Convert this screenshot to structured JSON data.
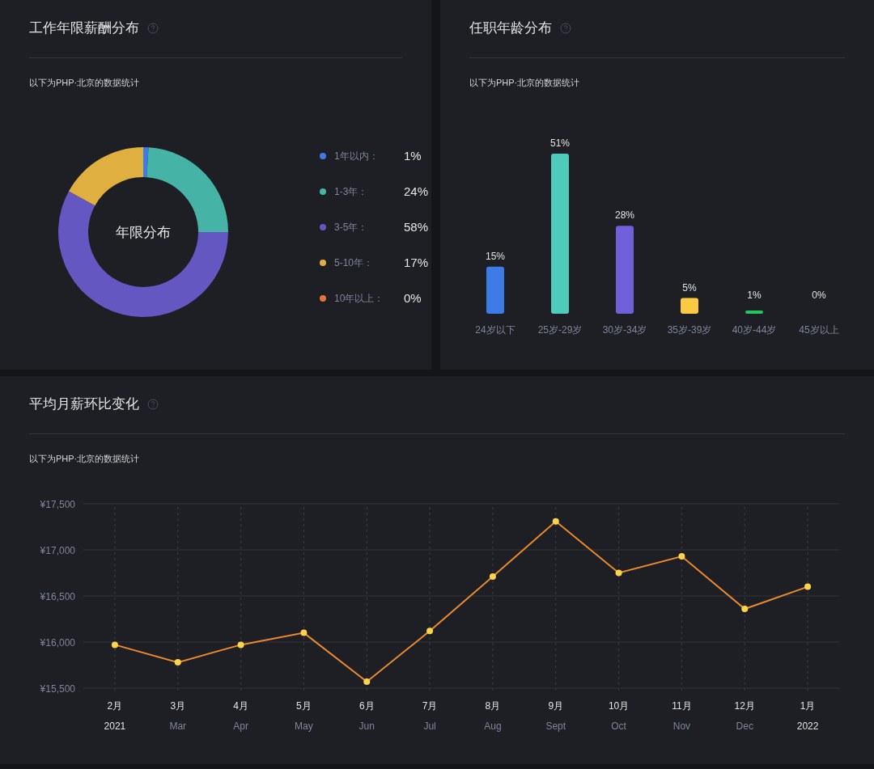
{
  "panels": [
    {
      "title": "工作年限薪酬分布",
      "subtitle": "以下为PHP·北京的数据统计",
      "center_label": "年限分布",
      "chart_data": {
        "type": "donut",
        "values": [
          1,
          24,
          58,
          17,
          0
        ]
      },
      "legend": [
        {
          "label": "1年以内：",
          "value": "1%",
          "color": "#3d7be6"
        },
        {
          "label": "1-3年：",
          "value": "24%",
          "color": "#45b4a6"
        },
        {
          "label": "3-5年：",
          "value": "58%",
          "color": "#6557c2"
        },
        {
          "label": "5-10年：",
          "value": "17%",
          "color": "#dfb03f"
        },
        {
          "label": "10年以上：",
          "value": "0%",
          "color": "#e8743b"
        }
      ]
    },
    {
      "title": "任职年龄分布",
      "subtitle": "以下为PHP·北京的数据统计",
      "chart_data": {
        "type": "bar",
        "categories": [
          "24岁以下",
          "25岁-29岁",
          "30岁-34岁",
          "35岁-39岁",
          "40岁-44岁",
          "45岁以上"
        ],
        "values": [
          15,
          51,
          28,
          5,
          1,
          0
        ],
        "data_labels": true,
        "value_labels": [
          "15%",
          "51%",
          "28%",
          "5%",
          "1%",
          "0%"
        ]
      },
      "bars": [
        {
          "color": "#3d7be6"
        },
        {
          "color": "#4ecbbb"
        },
        {
          "color": "#6f5fd9"
        },
        {
          "color": "#fcc942"
        },
        {
          "color": "#22c55e"
        }
      ]
    },
    {
      "title": "平均月薪环比变化",
      "subtitle": "以下为PHP·北京的数据统计",
      "chart_data": {
        "type": "line",
        "categories": [
          "2月",
          "3月",
          "4月",
          "5月",
          "6月",
          "7月",
          "8月",
          "9月",
          "10月",
          "11月",
          "12月",
          "1月"
        ],
        "series": [
          {
            "color": "#ea8a30",
            "marker": "circle",
            "values": [
              15970,
              15780,
              15970,
              16100,
              15570,
              16120,
              16710,
              17310,
              16750,
              16930,
              16360,
              16600
            ]
          }
        ],
        "ylim": [
          15500,
          17500
        ],
        "grid": true,
        "yticks": [
          {
            "value": 15500,
            "label": "¥15,500"
          },
          {
            "value": 16000,
            "label": "¥16,000"
          },
          {
            "value": 16500,
            "label": "¥16,500"
          },
          {
            "value": 17000,
            "label": "¥17,000"
          },
          {
            "value": 17500,
            "label": "¥17,500"
          }
        ]
      },
      "x_sublabels": [
        {
          "text": "2021",
          "kind": "year"
        },
        {
          "text": "Mar",
          "kind": "month"
        },
        {
          "text": "Apr",
          "kind": "month"
        },
        {
          "text": "May",
          "kind": "month"
        },
        {
          "text": "Jun",
          "kind": "month"
        },
        {
          "text": "Jul",
          "kind": "month"
        },
        {
          "text": "Aug",
          "kind": "month"
        },
        {
          "text": "Sept",
          "kind": "month"
        },
        {
          "text": "Oct",
          "kind": "month"
        },
        {
          "text": "Nov",
          "kind": "month"
        },
        {
          "text": "Dec",
          "kind": "month"
        },
        {
          "text": "2022",
          "kind": "year"
        }
      ]
    }
  ]
}
